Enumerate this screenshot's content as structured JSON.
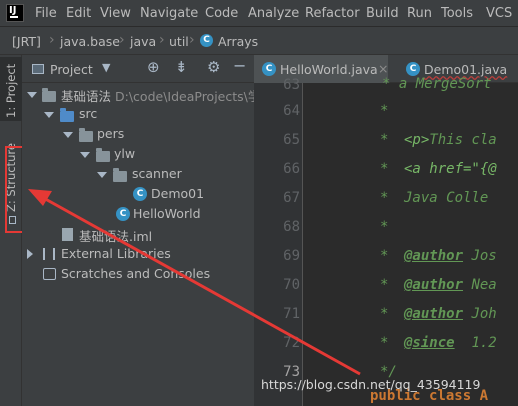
{
  "menubar": {
    "items": [
      "File",
      "Edit",
      "View",
      "Navigate",
      "Code",
      "Analyze",
      "Refactor",
      "Build",
      "Run",
      "Tools",
      "VCS"
    ]
  },
  "navbar": {
    "crumbs": [
      "[JRT]",
      "java.base",
      "java",
      "util",
      "Arrays"
    ]
  },
  "stripe": {
    "project_label": "1: Project",
    "structure_label": "Z: Structure"
  },
  "panel": {
    "title": "Project",
    "tree": {
      "root": "基础语法",
      "root_path": "D:\\code\\IdeaProjects\\学",
      "src": "src",
      "pers": "pers",
      "ylw": "ylw",
      "scanner": "scanner",
      "demo01": "Demo01",
      "helloworld": "HelloWorld",
      "iml": "基础语法.iml",
      "external": "External Libraries",
      "scratches": "Scratches and Consoles"
    }
  },
  "tabs": [
    "HelloWorld.java",
    "Demo01.java"
  ],
  "editor": {
    "line_numbers": [
      "63",
      "64",
      "65",
      "66",
      "67",
      "68",
      "69",
      "70",
      "71",
      "72",
      "73"
    ],
    "lines": {
      "l63": "* a MergeSort",
      "l64": "*",
      "l65_tag": "<p>",
      "l65_text": "This cla",
      "l66": "<a href=\"{@",
      "l67": "Java Colle",
      "l68": "*",
      "l69_tag": "@author",
      "l69_text": "Jos",
      "l70_tag": "@author",
      "l70_text": "Nea",
      "l71_tag": "@author",
      "l71_text": "Joh",
      "l72_tag": "@since",
      "l72_text": "1.2",
      "l73": "*/",
      "next": "public class A"
    }
  },
  "watermark": "https://blog.csdn.net/qq_43594119",
  "colors": {
    "annotation": "#e53935",
    "background": "#2b2b2b",
    "panel": "#3c3f41"
  }
}
